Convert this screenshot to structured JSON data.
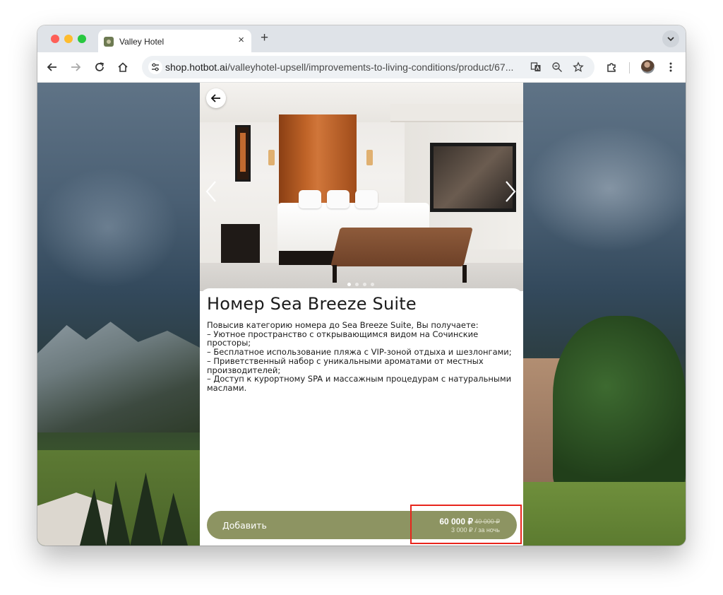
{
  "browser": {
    "tab_title": "Valley Hotel",
    "tab_close": "×",
    "new_tab": "+",
    "url_domain": "shop.hotbot.ai",
    "url_path": "/valleyhotel-upsell/improvements-to-living-conditions/product/67..."
  },
  "product": {
    "title": "Номер Sea Breeze Suite",
    "description_lines": [
      "Повысив категорию номера до Sea Breeze Suite, Вы получаете:",
      "– Уютное пространство с открывающимся видом на Сочинские просторы;",
      "– Бесплатное использование пляжа с VIP-зоной отдыха и шезлонгами;",
      "– Приветственный набор с уникальными ароматами от местных производителей;",
      "– Доступ к курортному SPA и массажным процедурам с натуральными маслами."
    ],
    "add_label": "Добавить",
    "price": "60 000 ₽",
    "old_price": "40 000 ₽",
    "price_per_night": "3 000 ₽ / за ночь",
    "gallery_dots": 4,
    "gallery_active_index": 0
  },
  "colors": {
    "accent": "#8d9462",
    "highlight": "#e8251c"
  }
}
